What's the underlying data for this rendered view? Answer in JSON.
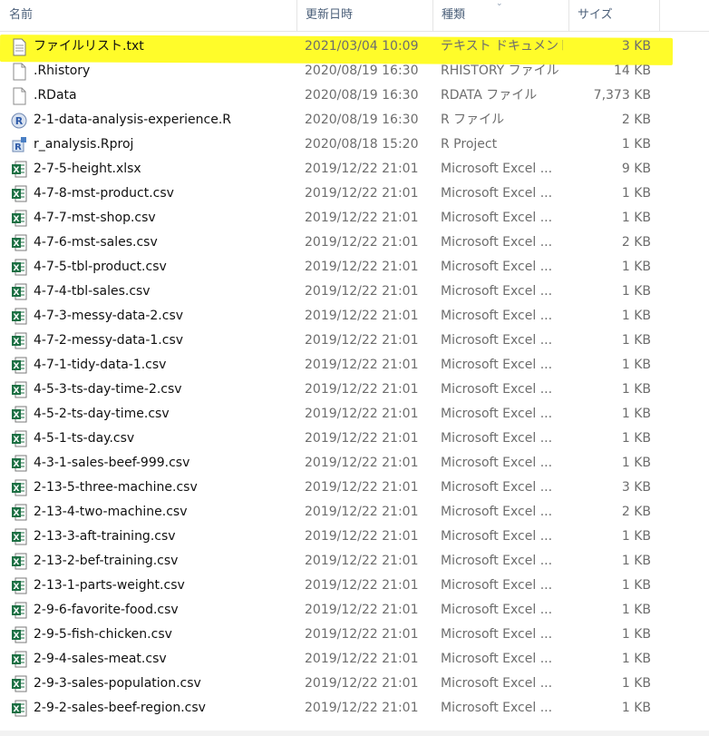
{
  "columns": {
    "name": "名前",
    "date": "更新日時",
    "type": "種類",
    "size": "サイズ"
  },
  "colors": {
    "highlight": "#fffc2a",
    "excel": "#1d7044"
  },
  "files": [
    {
      "name": "ファイルリスト.txt",
      "date": "2021/03/04 10:09",
      "type": "テキスト ドキュメント",
      "size": "3 KB",
      "icon": "text-file-icon",
      "highlighted": true
    },
    {
      "name": ".Rhistory",
      "date": "2020/08/19 16:30",
      "type": "RHISTORY ファイル",
      "size": "14 KB",
      "icon": "blank-file-icon"
    },
    {
      "name": ".RData",
      "date": "2020/08/19 16:30",
      "type": "RDATA ファイル",
      "size": "7,373 KB",
      "icon": "blank-file-icon"
    },
    {
      "name": "2-1-data-analysis-experience.R",
      "date": "2020/08/19 16:30",
      "type": "R ファイル",
      "size": "2 KB",
      "icon": "r-file-icon"
    },
    {
      "name": "r_analysis.Rproj",
      "date": "2020/08/18 15:20",
      "type": "R Project",
      "size": "1 KB",
      "icon": "rproj-file-icon"
    },
    {
      "name": "2-7-5-height.xlsx",
      "date": "2019/12/22 21:01",
      "type": "Microsoft Excel ...",
      "size": "9 KB",
      "icon": "excel-file-icon"
    },
    {
      "name": "4-7-8-mst-product.csv",
      "date": "2019/12/22 21:01",
      "type": "Microsoft Excel ...",
      "size": "1 KB",
      "icon": "excel-file-icon"
    },
    {
      "name": "4-7-7-mst-shop.csv",
      "date": "2019/12/22 21:01",
      "type": "Microsoft Excel ...",
      "size": "1 KB",
      "icon": "excel-file-icon"
    },
    {
      "name": "4-7-6-mst-sales.csv",
      "date": "2019/12/22 21:01",
      "type": "Microsoft Excel ...",
      "size": "2 KB",
      "icon": "excel-file-icon"
    },
    {
      "name": "4-7-5-tbl-product.csv",
      "date": "2019/12/22 21:01",
      "type": "Microsoft Excel ...",
      "size": "1 KB",
      "icon": "excel-file-icon"
    },
    {
      "name": "4-7-4-tbl-sales.csv",
      "date": "2019/12/22 21:01",
      "type": "Microsoft Excel ...",
      "size": "1 KB",
      "icon": "excel-file-icon"
    },
    {
      "name": "4-7-3-messy-data-2.csv",
      "date": "2019/12/22 21:01",
      "type": "Microsoft Excel ...",
      "size": "1 KB",
      "icon": "excel-file-icon"
    },
    {
      "name": "4-7-2-messy-data-1.csv",
      "date": "2019/12/22 21:01",
      "type": "Microsoft Excel ...",
      "size": "1 KB",
      "icon": "excel-file-icon"
    },
    {
      "name": "4-7-1-tidy-data-1.csv",
      "date": "2019/12/22 21:01",
      "type": "Microsoft Excel ...",
      "size": "1 KB",
      "icon": "excel-file-icon"
    },
    {
      "name": "4-5-3-ts-day-time-2.csv",
      "date": "2019/12/22 21:01",
      "type": "Microsoft Excel ...",
      "size": "1 KB",
      "icon": "excel-file-icon"
    },
    {
      "name": "4-5-2-ts-day-time.csv",
      "date": "2019/12/22 21:01",
      "type": "Microsoft Excel ...",
      "size": "1 KB",
      "icon": "excel-file-icon"
    },
    {
      "name": "4-5-1-ts-day.csv",
      "date": "2019/12/22 21:01",
      "type": "Microsoft Excel ...",
      "size": "1 KB",
      "icon": "excel-file-icon"
    },
    {
      "name": "4-3-1-sales-beef-999.csv",
      "date": "2019/12/22 21:01",
      "type": "Microsoft Excel ...",
      "size": "1 KB",
      "icon": "excel-file-icon"
    },
    {
      "name": "2-13-5-three-machine.csv",
      "date": "2019/12/22 21:01",
      "type": "Microsoft Excel ...",
      "size": "3 KB",
      "icon": "excel-file-icon"
    },
    {
      "name": "2-13-4-two-machine.csv",
      "date": "2019/12/22 21:01",
      "type": "Microsoft Excel ...",
      "size": "2 KB",
      "icon": "excel-file-icon"
    },
    {
      "name": "2-13-3-aft-training.csv",
      "date": "2019/12/22 21:01",
      "type": "Microsoft Excel ...",
      "size": "1 KB",
      "icon": "excel-file-icon"
    },
    {
      "name": "2-13-2-bef-training.csv",
      "date": "2019/12/22 21:01",
      "type": "Microsoft Excel ...",
      "size": "1 KB",
      "icon": "excel-file-icon"
    },
    {
      "name": "2-13-1-parts-weight.csv",
      "date": "2019/12/22 21:01",
      "type": "Microsoft Excel ...",
      "size": "1 KB",
      "icon": "excel-file-icon"
    },
    {
      "name": "2-9-6-favorite-food.csv",
      "date": "2019/12/22 21:01",
      "type": "Microsoft Excel ...",
      "size": "1 KB",
      "icon": "excel-file-icon"
    },
    {
      "name": "2-9-5-fish-chicken.csv",
      "date": "2019/12/22 21:01",
      "type": "Microsoft Excel ...",
      "size": "1 KB",
      "icon": "excel-file-icon"
    },
    {
      "name": "2-9-4-sales-meat.csv",
      "date": "2019/12/22 21:01",
      "type": "Microsoft Excel ...",
      "size": "1 KB",
      "icon": "excel-file-icon"
    },
    {
      "name": "2-9-3-sales-population.csv",
      "date": "2019/12/22 21:01",
      "type": "Microsoft Excel ...",
      "size": "1 KB",
      "icon": "excel-file-icon"
    },
    {
      "name": "2-9-2-sales-beef-region.csv",
      "date": "2019/12/22 21:01",
      "type": "Microsoft Excel ...",
      "size": "1 KB",
      "icon": "excel-file-icon"
    }
  ]
}
